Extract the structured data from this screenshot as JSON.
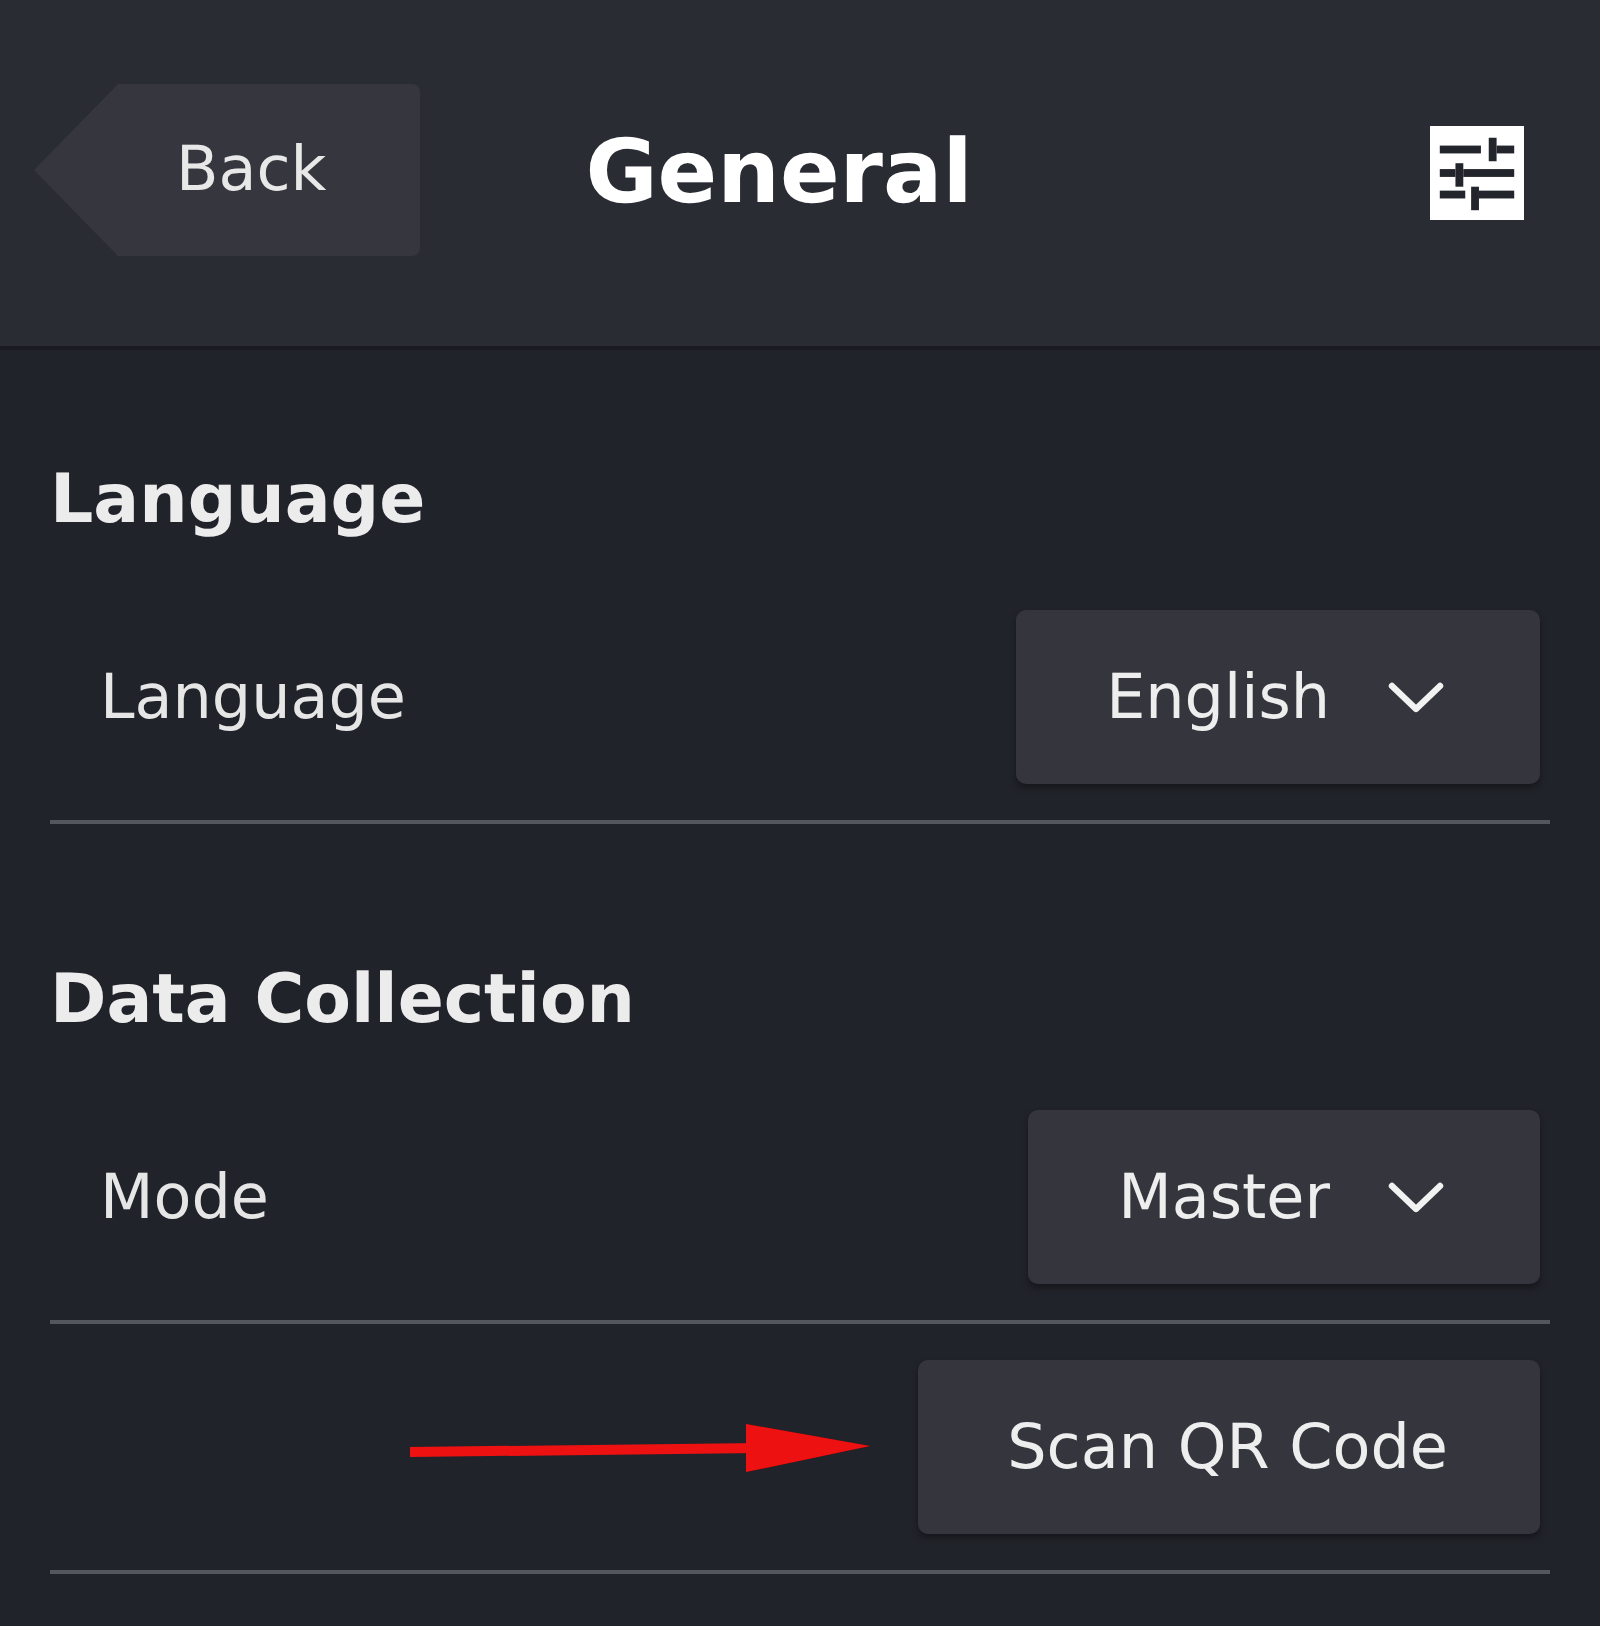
{
  "header": {
    "back_label": "Back",
    "title": "General"
  },
  "sections": [
    {
      "heading": "Language",
      "rows": [
        {
          "kind": "dropdown",
          "label": "Language",
          "value": "English"
        }
      ]
    },
    {
      "heading": "Data Collection",
      "rows": [
        {
          "kind": "dropdown",
          "label": "Mode",
          "value": "Master"
        },
        {
          "kind": "button",
          "label": "Scan QR Code",
          "pointer": true
        }
      ]
    }
  ]
}
